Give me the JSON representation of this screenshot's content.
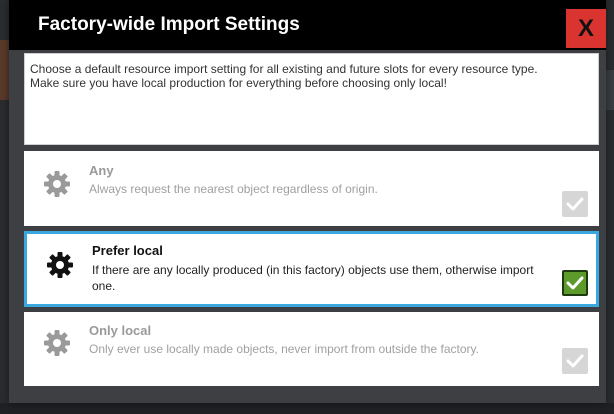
{
  "dialog": {
    "title": "Factory-wide Import Settings",
    "close_label": "X",
    "description": [
      "Choose a default resource import setting for all existing and future slots for every resource type.",
      "Make sure you have local production for everything before choosing only local!"
    ]
  },
  "options": [
    {
      "title": "Any",
      "description": "Always request the nearest object regardless of origin.",
      "selected": false
    },
    {
      "title": "Prefer local",
      "description": "If there are any locally produced (in this factory) objects use them, otherwise import one.",
      "selected": true
    },
    {
      "title": "Only local",
      "description": "Only ever use locally made objects, never import from outside the factory.",
      "selected": false
    }
  ],
  "colors": {
    "selected_border": "#3aa7de",
    "check_on": "#5c9a2c",
    "close_button": "#d9342f"
  },
  "icons": {
    "option_icon": "gear-icon",
    "check_icon": "checkmark-icon"
  }
}
